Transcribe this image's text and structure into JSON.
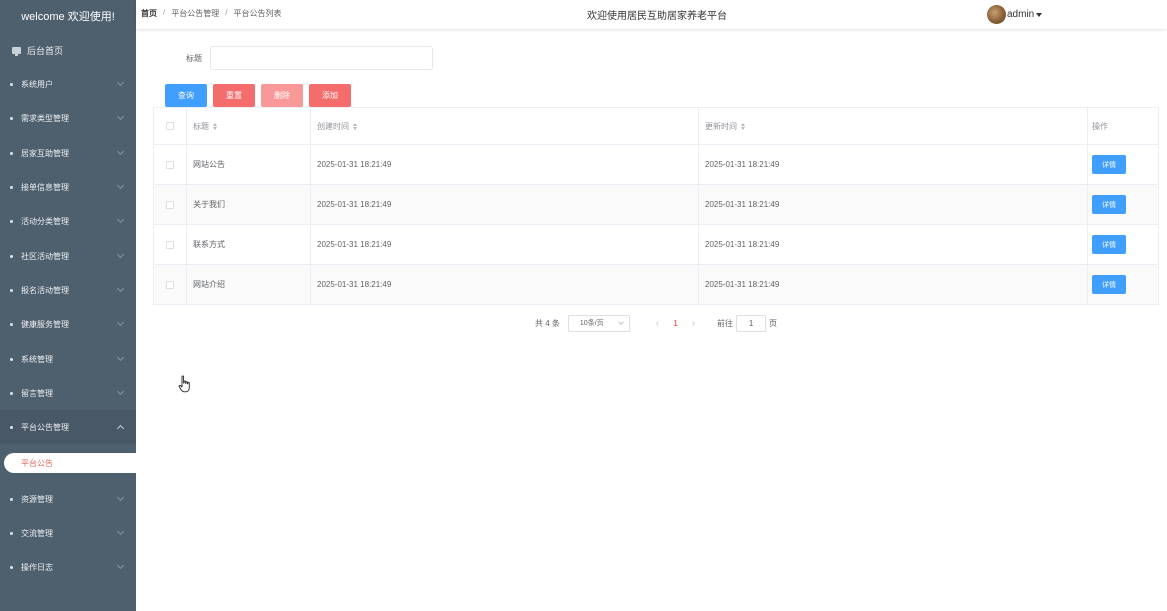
{
  "sidebar": {
    "welcome": "welcome 欢迎使用!",
    "home": "后台首页",
    "items": [
      {
        "label": "系统用户"
      },
      {
        "label": "需求类型管理"
      },
      {
        "label": "居家互助管理"
      },
      {
        "label": "接单信息管理"
      },
      {
        "label": "活动分类管理"
      },
      {
        "label": "社区活动管理"
      },
      {
        "label": "报名活动管理"
      },
      {
        "label": "健康服务管理"
      },
      {
        "label": "系统管理"
      },
      {
        "label": "留言管理"
      },
      {
        "label": "平台公告管理"
      },
      {
        "label": "资源管理"
      },
      {
        "label": "交流管理"
      },
      {
        "label": "操作日志"
      }
    ],
    "active_sub": "平台公告"
  },
  "header": {
    "breadcrumb": [
      "首页",
      "平台公告管理",
      "平台公告列表"
    ],
    "breadcrumb_sep": "/",
    "site_title": "欢迎使用居民互助居家养老平台",
    "username": "admin"
  },
  "search": {
    "label": "标题",
    "value": "",
    "buttons": {
      "query": "查询",
      "reset": "重置",
      "delete": "删除",
      "add": "添加"
    }
  },
  "table": {
    "columns": [
      "标题",
      "创建时间",
      "更新时间",
      "操作"
    ],
    "rows": [
      {
        "title": "网站公告",
        "created": "2025-01-31 18:21:49",
        "updated": "2025-01-31 18:21:49",
        "action": "详情"
      },
      {
        "title": "关于我们",
        "created": "2025-01-31 18:21:49",
        "updated": "2025-01-31 18:21:49",
        "action": "详情"
      },
      {
        "title": "联系方式",
        "created": "2025-01-31 18:21:49",
        "updated": "2025-01-31 18:21:49",
        "action": "详情"
      },
      {
        "title": "网站介绍",
        "created": "2025-01-31 18:21:49",
        "updated": "2025-01-31 18:21:49",
        "action": "详情"
      }
    ]
  },
  "pagination": {
    "total": "共 4 条",
    "page_size": "10条/页",
    "prev": "‹",
    "current": "1",
    "next": "›",
    "goto_label": "前往",
    "goto_value": "1",
    "goto_suffix": "页"
  }
}
